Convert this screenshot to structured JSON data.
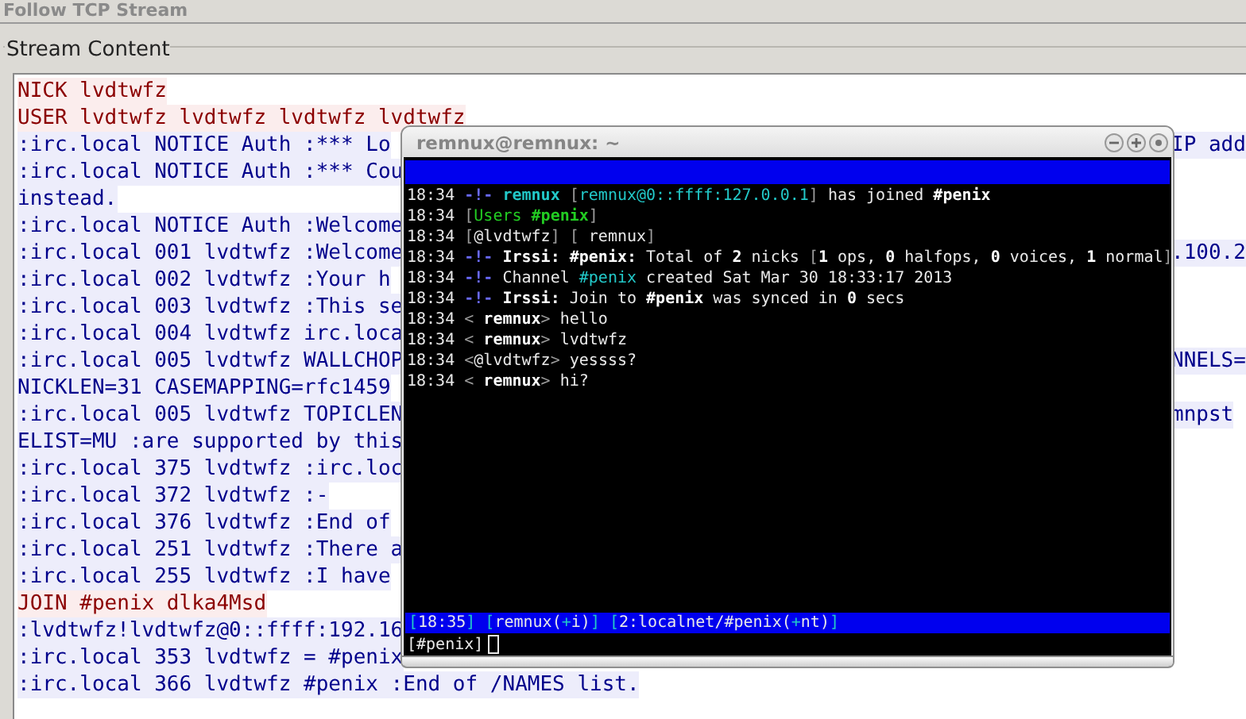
{
  "window": {
    "title": "Follow TCP Stream"
  },
  "stream": {
    "label": "Stream Content",
    "lines": [
      {
        "kind": "client",
        "text": "NICK lvdtwfz"
      },
      {
        "kind": "client",
        "text": "USER lvdtwfz lvdtwfz lvdtwfz lvdtwfz"
      },
      {
        "kind": "server",
        "text": ":irc.local NOTICE Auth :*** Lo",
        "right": "IP add"
      },
      {
        "kind": "server",
        "text": ":irc.local NOTICE Auth :*** Cou"
      },
      {
        "kind": "server",
        "text": "instead."
      },
      {
        "kind": "server",
        "text": ":irc.local NOTICE Auth :Welcome"
      },
      {
        "kind": "server",
        "text": ":irc.local 001 lvdtwfz :Welcome",
        "right": ".100.2"
      },
      {
        "kind": "server",
        "text": ":irc.local 002 lvdtwfz :Your h"
      },
      {
        "kind": "server",
        "text": ":irc.local 003 lvdtwfz :This se"
      },
      {
        "kind": "server",
        "text": ":irc.local 004 lvdtwfz irc.loca"
      },
      {
        "kind": "server",
        "text": ":irc.local 005 lvdtwfz WALLCHOP",
        "right": "NNELS="
      },
      {
        "kind": "server",
        "text": "NICKLEN=31 CASEMAPPING=rfc1459"
      },
      {
        "kind": "server",
        "text": ":irc.local 005 lvdtwfz TOPICLEN",
        "right": "mnpst"
      },
      {
        "kind": "server",
        "text": "ELIST=MU :are supported by this"
      },
      {
        "kind": "server",
        "text": ":irc.local 375 lvdtwfz :irc.loc"
      },
      {
        "kind": "server",
        "text": ":irc.local 372 lvdtwfz :-"
      },
      {
        "kind": "server",
        "text": ":irc.local 376 lvdtwfz :End of"
      },
      {
        "kind": "server",
        "text": ":irc.local 251 lvdtwfz :There a"
      },
      {
        "kind": "server",
        "text": ":irc.local 255 lvdtwfz :I have"
      },
      {
        "kind": "client",
        "text": "JOIN #penix dlka4Msd"
      },
      {
        "kind": "server",
        "text": ":lvdtwfz!lvdtwfz@0::ffff:192.16"
      },
      {
        "kind": "server",
        "text": ":irc.local 353 lvdtwfz = #penix"
      },
      {
        "kind": "server",
        "text": ":irc.local 366 lvdtwfz #penix :End of /NAMES list."
      }
    ]
  },
  "terminal": {
    "title": "remnux@remnux: ~",
    "lines": [
      [
        {
          "kind": "plain",
          "text": "18:34 "
        },
        {
          "kind": "blue",
          "text": "-!- "
        },
        {
          "kind": "cyan_bold",
          "text": "remnux"
        },
        {
          "kind": "dim",
          "text": " ["
        },
        {
          "kind": "cyan",
          "text": "remnux@0::ffff:127.0.0.1"
        },
        {
          "kind": "dim",
          "text": "]"
        },
        {
          "kind": "plain",
          "text": " has joined "
        },
        {
          "kind": "bold",
          "text": "#penix"
        }
      ],
      [
        {
          "kind": "plain",
          "text": "18:34 "
        },
        {
          "kind": "dim",
          "text": "["
        },
        {
          "kind": "green",
          "text": "Users "
        },
        {
          "kind": "green_bold",
          "text": "#penix"
        },
        {
          "kind": "dim",
          "text": "]"
        }
      ],
      [
        {
          "kind": "plain",
          "text": "18:34 "
        },
        {
          "kind": "dim",
          "text": "["
        },
        {
          "kind": "plain",
          "text": "@lvdtwfz"
        },
        {
          "kind": "dim",
          "text": "] ["
        },
        {
          "kind": "plain",
          "text": " remnux"
        },
        {
          "kind": "dim",
          "text": "]"
        }
      ],
      [
        {
          "kind": "plain",
          "text": "18:34 "
        },
        {
          "kind": "blue",
          "text": "-!- "
        },
        {
          "kind": "bold",
          "text": "Irssi: #penix:"
        },
        {
          "kind": "plain",
          "text": " Total of "
        },
        {
          "kind": "bold",
          "text": "2"
        },
        {
          "kind": "plain",
          "text": " nicks "
        },
        {
          "kind": "dim",
          "text": "["
        },
        {
          "kind": "bold",
          "text": "1"
        },
        {
          "kind": "plain",
          "text": " ops, "
        },
        {
          "kind": "bold",
          "text": "0"
        },
        {
          "kind": "plain",
          "text": " halfops, "
        },
        {
          "kind": "bold",
          "text": "0"
        },
        {
          "kind": "plain",
          "text": " voices, "
        },
        {
          "kind": "bold",
          "text": "1"
        },
        {
          "kind": "plain",
          "text": " normal"
        },
        {
          "kind": "dim",
          "text": "]"
        }
      ],
      [
        {
          "kind": "plain",
          "text": "18:34 "
        },
        {
          "kind": "blue",
          "text": "-!- "
        },
        {
          "kind": "plain",
          "text": "Channel "
        },
        {
          "kind": "cyan",
          "text": "#penix"
        },
        {
          "kind": "plain",
          "text": " created Sat Mar 30 18:33:17 2013"
        }
      ],
      [
        {
          "kind": "plain",
          "text": "18:34 "
        },
        {
          "kind": "blue",
          "text": "-!- "
        },
        {
          "kind": "bold",
          "text": "Irssi:"
        },
        {
          "kind": "plain",
          "text": " Join to "
        },
        {
          "kind": "bold",
          "text": "#penix"
        },
        {
          "kind": "plain",
          "text": " was synced in "
        },
        {
          "kind": "bold",
          "text": "0"
        },
        {
          "kind": "plain",
          "text": " secs"
        }
      ],
      [
        {
          "kind": "plain",
          "text": "18:34 "
        },
        {
          "kind": "dim",
          "text": "< "
        },
        {
          "kind": "bold",
          "text": "remnux"
        },
        {
          "kind": "dim",
          "text": ">"
        },
        {
          "kind": "plain",
          "text": " hello"
        }
      ],
      [
        {
          "kind": "plain",
          "text": "18:34 "
        },
        {
          "kind": "dim",
          "text": "< "
        },
        {
          "kind": "bold",
          "text": "remnux"
        },
        {
          "kind": "dim",
          "text": ">"
        },
        {
          "kind": "plain",
          "text": " lvdtwfz"
        }
      ],
      [
        {
          "kind": "plain",
          "text": "18:34 "
        },
        {
          "kind": "dim",
          "text": "<"
        },
        {
          "kind": "plain",
          "text": "@lvdtwfz"
        },
        {
          "kind": "dim",
          "text": ">"
        },
        {
          "kind": "plain",
          "text": " yessss?"
        }
      ],
      [
        {
          "kind": "plain",
          "text": "18:34 "
        },
        {
          "kind": "dim",
          "text": "< "
        },
        {
          "kind": "bold",
          "text": "remnux"
        },
        {
          "kind": "dim",
          "text": ">"
        },
        {
          "kind": "plain",
          "text": " hi?"
        }
      ]
    ],
    "status": [
      {
        "kind": "cyan",
        "text": " ["
      },
      {
        "kind": "plain",
        "text": "18:35"
      },
      {
        "kind": "cyan",
        "text": "] ["
      },
      {
        "kind": "plain",
        "text": "remnux("
      },
      {
        "kind": "cyan",
        "text": "+"
      },
      {
        "kind": "plain",
        "text": "i)"
      },
      {
        "kind": "cyan",
        "text": "] ["
      },
      {
        "kind": "plain",
        "text": "2:localnet/#penix("
      },
      {
        "kind": "cyan",
        "text": "+"
      },
      {
        "kind": "plain",
        "text": "nt)"
      },
      {
        "kind": "cyan",
        "text": "]"
      }
    ],
    "prompt": "[#penix]"
  }
}
